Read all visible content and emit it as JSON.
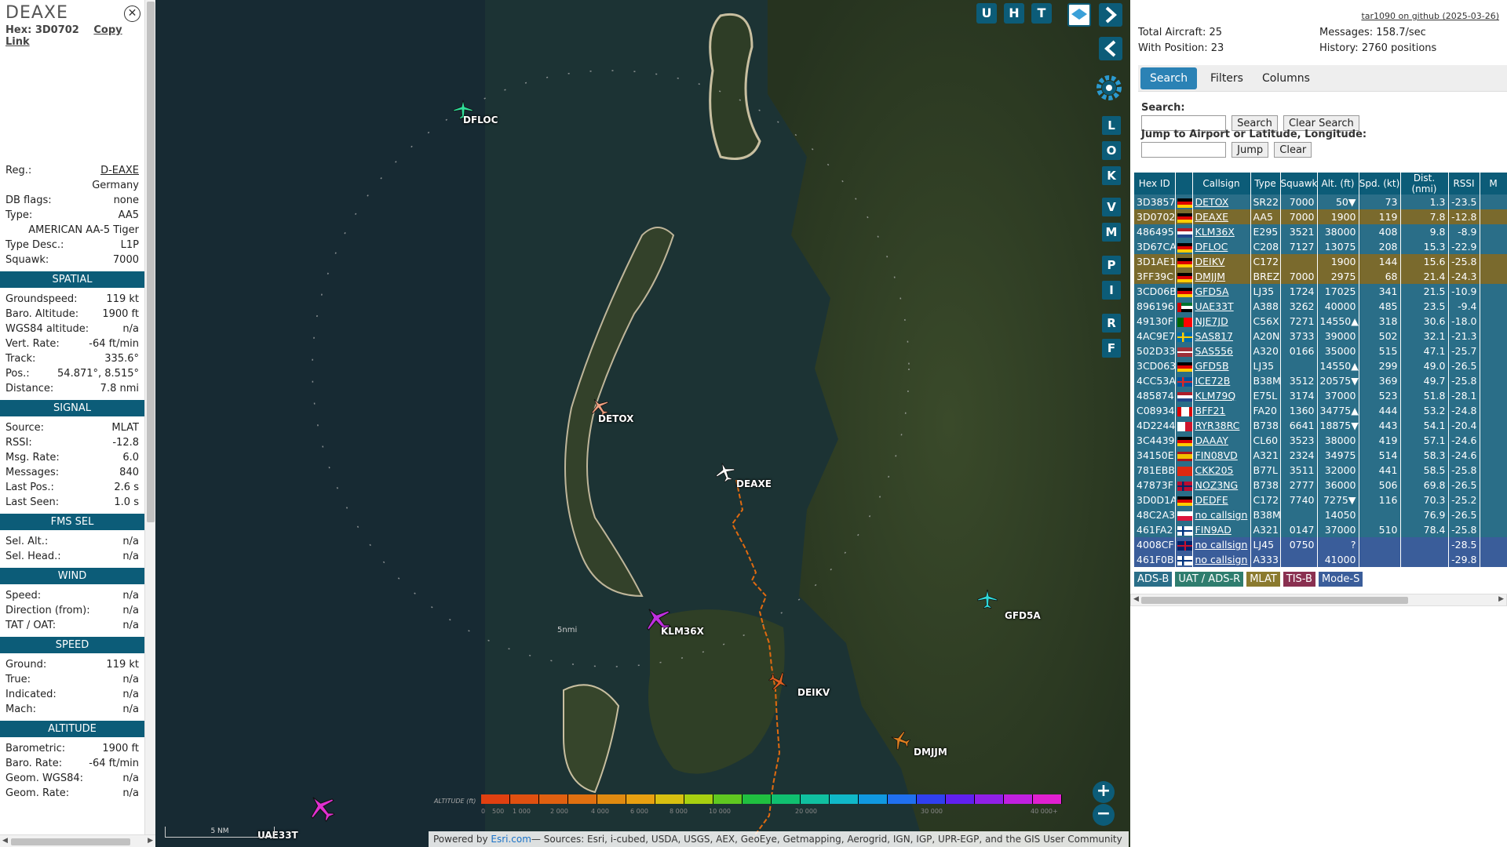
{
  "info": {
    "registration": "DEAXE",
    "hex_label": "Hex:",
    "hex": "3D0702",
    "copy_link": "Copy Link",
    "fields": [
      {
        "label": "Reg.:",
        "value": "D-EAXE",
        "link": true
      },
      {
        "label": "",
        "value": "Germany"
      },
      {
        "label": "DB flags:",
        "value": "none"
      },
      {
        "label": "Type:",
        "value": "AA5"
      },
      {
        "label": "",
        "value": "AMERICAN AA-5 Tiger"
      },
      {
        "label": "Type Desc.:",
        "value": "L1P"
      },
      {
        "label": "Squawk:",
        "value": "7000"
      }
    ],
    "sections": [
      {
        "title": "SPATIAL",
        "rows": [
          {
            "label": "Groundspeed:",
            "value": "119 kt"
          },
          {
            "label": "Baro. Altitude:",
            "value": "1900 ft"
          },
          {
            "label": "WGS84 altitude:",
            "value": "n/a"
          },
          {
            "label": "Vert. Rate:",
            "value": "-64 ft/min"
          },
          {
            "label": "Track:",
            "value": "335.6°"
          },
          {
            "label": "Pos.:",
            "value": "54.871°, 8.515°"
          },
          {
            "label": "Distance:",
            "value": "7.8 nmi"
          }
        ]
      },
      {
        "title": "SIGNAL",
        "rows": [
          {
            "label": "Source:",
            "value": "MLAT"
          },
          {
            "label": "RSSI:",
            "value": "-12.8"
          },
          {
            "label": "Msg. Rate:",
            "value": "6.0"
          },
          {
            "label": "Messages:",
            "value": "840"
          },
          {
            "label": "Last Pos.:",
            "value": "2.6 s"
          },
          {
            "label": "Last Seen:",
            "value": "1.0 s"
          }
        ]
      },
      {
        "title": "FMS SEL",
        "rows": [
          {
            "label": "Sel. Alt.:",
            "value": "n/a"
          },
          {
            "label": "Sel. Head.:",
            "value": "n/a"
          }
        ]
      },
      {
        "title": "WIND",
        "rows": [
          {
            "label": "Speed:",
            "value": "n/a"
          },
          {
            "label": "Direction (from):",
            "value": "n/a"
          },
          {
            "label": "TAT / OAT:",
            "value": "n/a"
          }
        ]
      },
      {
        "title": "SPEED",
        "rows": [
          {
            "label": "Ground:",
            "value": "119 kt"
          },
          {
            "label": "True:",
            "value": "n/a"
          },
          {
            "label": "Indicated:",
            "value": "n/a"
          },
          {
            "label": "Mach:",
            "value": "n/a"
          }
        ]
      },
      {
        "title": "ALTITUDE",
        "rows": [
          {
            "label": "Barometric:",
            "value": "1900 ft"
          },
          {
            "label": "Baro. Rate:",
            "value": "-64 ft/min"
          },
          {
            "label": "Geom. WGS84:",
            "value": "n/a"
          },
          {
            "label": "Geom. Rate:",
            "value": "n/a"
          }
        ]
      }
    ]
  },
  "map": {
    "buttons_top": [
      "U",
      "H",
      "T"
    ],
    "side_buttons": [
      "L",
      "O",
      "K",
      "V",
      "M",
      "P",
      "I",
      "R",
      "F"
    ],
    "planes": [
      {
        "callsign": "DFLOC",
        "color": "#2fe09a"
      },
      {
        "callsign": "DETOX",
        "color": "#f0a080"
      },
      {
        "callsign": "DEAXE",
        "color": "#ffffff"
      },
      {
        "callsign": "KLM36X",
        "color": "#c030e0"
      },
      {
        "callsign": "GFD5A",
        "color": "#30d8d8"
      },
      {
        "callsign": "DEIKV",
        "color": "#e06020"
      },
      {
        "callsign": "DMJJM",
        "color": "#e08020"
      },
      {
        "callsign": "UAE33T",
        "color": "#e030d0"
      }
    ],
    "range_label": "5nmi",
    "altitude_label": "ALTITUDE (ft)",
    "altitude_ticks": [
      "0",
      "500",
      "1 000",
      "2 000",
      "4 000",
      "6 000",
      "8 000",
      "10 000",
      "20 000",
      "30 000",
      "40 000+"
    ],
    "altitude_colors": [
      "#e04010",
      "#e05010",
      "#e06010",
      "#e07010",
      "#e08a10",
      "#e8a010",
      "#d8c010",
      "#a8d010",
      "#60c820",
      "#20c040",
      "#10c070",
      "#10c0a0",
      "#10b8c8",
      "#1098e0",
      "#2070f0",
      "#3040f0",
      "#6020f0",
      "#9020e8",
      "#c020e0",
      "#e020d0"
    ],
    "scale": "5 NM",
    "attribution_prefix": "Powered by ",
    "attribution_link": "Esri.com",
    "attribution_rest": "— Sources: Esri, i-cubed, USDA, USGS, AEX, GeoEye, Getmapping, Aerogrid, IGN, IGP, UPR-EGP, and the GIS User Community",
    "zoom_in": "+",
    "zoom_out": "−"
  },
  "panel": {
    "github": "tar1090 on github (2025-03-26)",
    "total_aircraft": "Total Aircraft: 25",
    "with_position": "With Position: 23",
    "messages": "Messages: 158.7/sec",
    "history": "History: 2760 positions",
    "tabs": [
      "Search",
      "Filters",
      "Columns"
    ],
    "search_label": "Search:",
    "search_button": "Search",
    "clear_search": "Clear Search",
    "jump_label": "Jump to Airport or Latitude, Longitude:",
    "jump_button": "Jump",
    "clear_button": "Clear",
    "columns": [
      "Hex ID",
      "",
      "Callsign",
      "Type",
      "Squawk",
      "Alt. (ft)",
      "Spd. (kt)",
      "Dist. (nmi)",
      "RSSI",
      "M"
    ],
    "rows": [
      {
        "hex": "3D3857",
        "flag": "de",
        "callsign": "DETOX",
        "type": "SR22",
        "squawk": "7000",
        "alt": "50▼",
        "spd": "73",
        "dist": "1.3",
        "rssi": "-23.5",
        "cls": "pos"
      },
      {
        "hex": "3D0702",
        "flag": "de",
        "callsign": "DEAXE",
        "type": "AA5",
        "squawk": "7000",
        "alt": "1900",
        "spd": "119",
        "dist": "7.8",
        "rssi": "-12.8",
        "cls": "sel"
      },
      {
        "hex": "486495",
        "flag": "nl",
        "callsign": "KLM36X",
        "type": "E295",
        "squawk": "3521",
        "alt": "38000",
        "spd": "408",
        "dist": "9.8",
        "rssi": "-8.9",
        "cls": "pos"
      },
      {
        "hex": "3D67CA",
        "flag": "de",
        "callsign": "DFLOC",
        "type": "C208",
        "squawk": "7127",
        "alt": "13075",
        "spd": "208",
        "dist": "15.3",
        "rssi": "-22.9",
        "cls": "pos"
      },
      {
        "hex": "3D1AE1",
        "flag": "de",
        "callsign": "DEIKV",
        "type": "C172",
        "squawk": "",
        "alt": "1900",
        "spd": "144",
        "dist": "15.6",
        "rssi": "-25.8",
        "cls": "sel"
      },
      {
        "hex": "3FF39C",
        "flag": "de",
        "callsign": "DMJJM",
        "type": "BREZ",
        "squawk": "7000",
        "alt": "2975",
        "spd": "68",
        "dist": "21.4",
        "rssi": "-24.3",
        "cls": "sel"
      },
      {
        "hex": "3CD06B",
        "flag": "de",
        "callsign": "GFD5A",
        "type": "LJ35",
        "squawk": "1724",
        "alt": "17025",
        "spd": "341",
        "dist": "21.5",
        "rssi": "-10.9",
        "cls": "pos"
      },
      {
        "hex": "896196",
        "flag": "ae",
        "callsign": "UAE33T",
        "type": "A388",
        "squawk": "3262",
        "alt": "40000",
        "spd": "485",
        "dist": "23.5",
        "rssi": "-9.4",
        "cls": "pos"
      },
      {
        "hex": "49130F",
        "flag": "pt",
        "callsign": "NJE7JD",
        "type": "C56X",
        "squawk": "7271",
        "alt": "14550▲",
        "spd": "318",
        "dist": "30.6",
        "rssi": "-18.0",
        "cls": "pos"
      },
      {
        "hex": "4AC9E7",
        "flag": "se",
        "callsign": "SAS817",
        "type": "A20N",
        "squawk": "3733",
        "alt": "39000",
        "spd": "502",
        "dist": "32.1",
        "rssi": "-21.3",
        "cls": "pos"
      },
      {
        "hex": "502D33",
        "flag": "lv",
        "callsign": "SAS556",
        "type": "A320",
        "squawk": "0166",
        "alt": "35000",
        "spd": "515",
        "dist": "47.1",
        "rssi": "-25.7",
        "cls": "pos"
      },
      {
        "hex": "3CD063",
        "flag": "de",
        "callsign": "GFD5B",
        "type": "LJ35",
        "squawk": "",
        "alt": "14550▲",
        "spd": "299",
        "dist": "49.0",
        "rssi": "-26.5",
        "cls": "pos"
      },
      {
        "hex": "4CC53A",
        "flag": "is",
        "callsign": "ICE72B",
        "type": "B38M",
        "squawk": "3512",
        "alt": "20575▼",
        "spd": "369",
        "dist": "49.7",
        "rssi": "-25.8",
        "cls": "pos"
      },
      {
        "hex": "485874",
        "flag": "nl",
        "callsign": "KLM79Q",
        "type": "E75L",
        "squawk": "3174",
        "alt": "37000",
        "spd": "523",
        "dist": "51.8",
        "rssi": "-28.1",
        "cls": "pos"
      },
      {
        "hex": "C08934",
        "flag": "ca",
        "callsign": "BFF21",
        "type": "FA20",
        "squawk": "1360",
        "alt": "34775▲",
        "spd": "444",
        "dist": "53.2",
        "rssi": "-24.8",
        "cls": "pos"
      },
      {
        "hex": "4D2244",
        "flag": "mt",
        "callsign": "RYR38RC",
        "type": "B738",
        "squawk": "6641",
        "alt": "18875▼",
        "spd": "443",
        "dist": "54.1",
        "rssi": "-20.4",
        "cls": "pos"
      },
      {
        "hex": "3C4439",
        "flag": "de",
        "callsign": "DAAAY",
        "type": "CL60",
        "squawk": "3523",
        "alt": "38000",
        "spd": "419",
        "dist": "57.1",
        "rssi": "-24.6",
        "cls": "pos"
      },
      {
        "hex": "34150E",
        "flag": "es",
        "callsign": "FIN08VD",
        "type": "A321",
        "squawk": "2324",
        "alt": "34975",
        "spd": "514",
        "dist": "58.3",
        "rssi": "-24.6",
        "cls": "pos"
      },
      {
        "hex": "781EBB",
        "flag": "cn",
        "callsign": "CKK205",
        "type": "B77L",
        "squawk": "3511",
        "alt": "32000",
        "spd": "441",
        "dist": "58.5",
        "rssi": "-25.8",
        "cls": "pos"
      },
      {
        "hex": "47873F",
        "flag": "no",
        "callsign": "NOZ3NG",
        "type": "B738",
        "squawk": "2777",
        "alt": "36000",
        "spd": "506",
        "dist": "69.8",
        "rssi": "-26.5",
        "cls": "pos"
      },
      {
        "hex": "3D0D1A",
        "flag": "de",
        "callsign": "DEDFE",
        "type": "C172",
        "squawk": "7740",
        "alt": "7275▼",
        "spd": "116",
        "dist": "70.3",
        "rssi": "-25.2",
        "cls": "pos"
      },
      {
        "hex": "48C2A3",
        "flag": "pl",
        "callsign": "no callsign",
        "type": "B38M",
        "squawk": "",
        "alt": "14050",
        "spd": "",
        "dist": "76.9",
        "rssi": "-26.5",
        "cls": "pos"
      },
      {
        "hex": "461FA2",
        "flag": "fi",
        "callsign": "FIN9AD",
        "type": "A321",
        "squawk": "0147",
        "alt": "37000",
        "spd": "510",
        "dist": "78.4",
        "rssi": "-25.8",
        "cls": "pos"
      },
      {
        "hex": "4008CF",
        "flag": "gb",
        "callsign": "no callsign",
        "type": "LJ45",
        "squawk": "0750",
        "alt": "?",
        "spd": "",
        "dist": "",
        "rssi": "-28.5",
        "cls": "nopos"
      },
      {
        "hex": "461F0B",
        "flag": "fi",
        "callsign": "no callsign",
        "type": "A333",
        "squawk": "",
        "alt": "41000",
        "spd": "",
        "dist": "",
        "rssi": "-29.8",
        "cls": "nopos"
      }
    ],
    "source_legend": [
      {
        "label": "ADS-B",
        "color": "#2a6e88"
      },
      {
        "label": "UAT / ADS-R",
        "color": "#2f7d6e"
      },
      {
        "label": "MLAT",
        "color": "#8b7a2e"
      },
      {
        "label": "TIS-B",
        "color": "#8a3050"
      },
      {
        "label": "Mode-S",
        "color": "#3a5d9a"
      }
    ]
  }
}
